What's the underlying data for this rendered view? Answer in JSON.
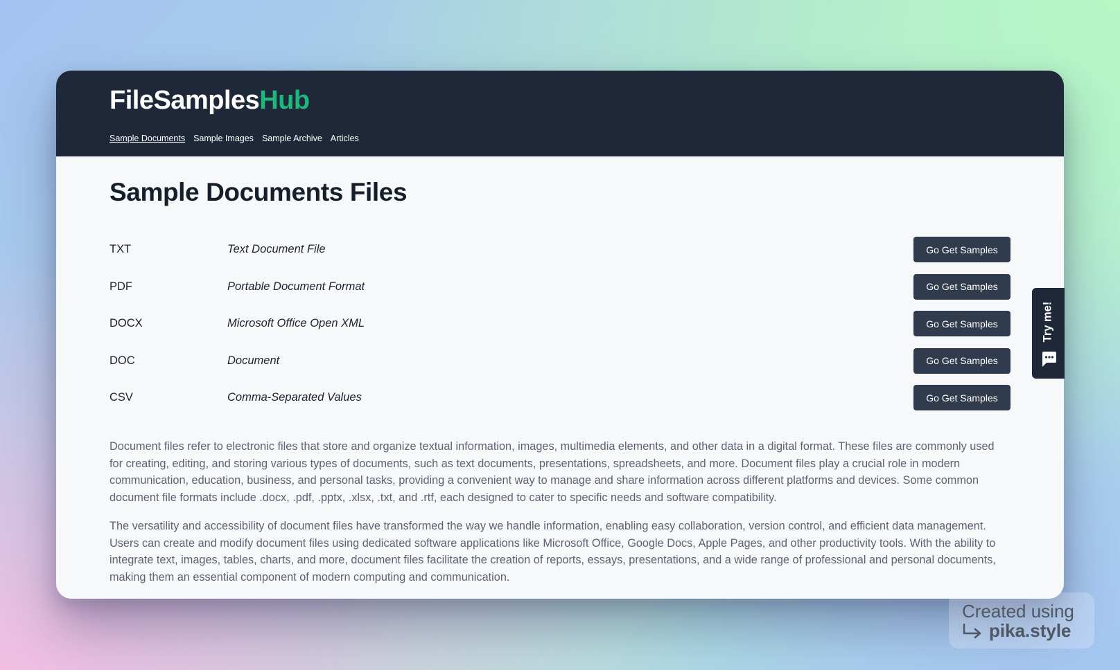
{
  "site": {
    "logo_main": "FileSamples",
    "logo_accent": "Hub",
    "nav": [
      {
        "label": "Sample Documents",
        "active": true
      },
      {
        "label": "Sample Images",
        "active": false
      },
      {
        "label": "Sample Archive",
        "active": false
      },
      {
        "label": "Articles",
        "active": false
      }
    ]
  },
  "main": {
    "title": "Sample Documents Files",
    "formats": [
      {
        "code": "TXT",
        "description": "Text Document File",
        "button": "Go Get Samples"
      },
      {
        "code": "PDF",
        "description": "Portable Document Format",
        "button": "Go Get Samples"
      },
      {
        "code": "DOCX",
        "description": "Microsoft Office Open XML",
        "button": "Go Get Samples"
      },
      {
        "code": "DOC",
        "description": "Document",
        "button": "Go Get Samples"
      },
      {
        "code": "CSV",
        "description": "Comma-Separated Values",
        "button": "Go Get Samples"
      }
    ],
    "paragraphs": [
      "Document files refer to electronic files that store and organize textual information, images, multimedia elements, and other data in a digital format. These files are commonly used for creating, editing, and storing various types of documents, such as text documents, presentations, spreadsheets, and more. Document files play a crucial role in modern communication, education, business, and personal tasks, providing a convenient way to manage and share information across different platforms and devices. Some common document file formats include .docx, .pdf, .pptx, .xlsx, .txt, and .rtf, each designed to cater to specific needs and software compatibility.",
      "The versatility and accessibility of document files have transformed the way we handle information, enabling easy collaboration, version control, and efficient data management. Users can create and modify document files using dedicated software applications like Microsoft Office, Google Docs, Apple Pages, and other productivity tools. With the ability to integrate text, images, tables, charts, and more, document files facilitate the creation of reports, essays, presentations, and a wide range of professional and personal documents, making them an essential component of modern computing and communication."
    ]
  },
  "widget": {
    "label": "Try me!",
    "icon": "chat-bubble-icon"
  },
  "watermark": {
    "line1": "Created using",
    "line2": "pika.style",
    "icon": "arrow-return-right-icon"
  },
  "colors": {
    "header_bg": "#1f2838",
    "logo_accent": "#1fb87c",
    "button_bg": "#313b4e",
    "page_bg": "#f6f8fa",
    "body_text": "#5b6472"
  }
}
